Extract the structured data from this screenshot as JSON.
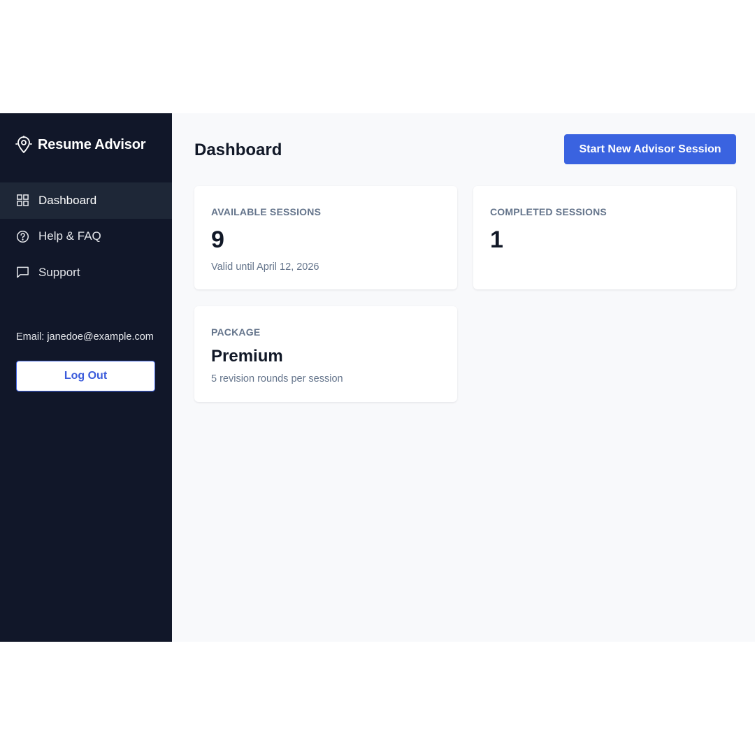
{
  "brand": {
    "name": "Resume Advisor",
    "icon": "location-pin-icon"
  },
  "nav": {
    "items": [
      {
        "label": "Dashboard",
        "icon": "grid-icon",
        "active": true
      },
      {
        "label": "Help & FAQ",
        "icon": "help-circle-icon",
        "active": false
      },
      {
        "label": "Support",
        "icon": "message-square-icon",
        "active": false
      }
    ]
  },
  "user": {
    "email": "Email: janedoe@example.com"
  },
  "logout_label": "Log Out",
  "main": {
    "title": "Dashboard",
    "primary_action": "Start New Advisor Session"
  },
  "cards": {
    "available": {
      "label": "AVAILABLE SESSIONS",
      "value": "9",
      "sub": "Valid until April 12, 2026"
    },
    "completed": {
      "label": "COMPLETED SESSIONS",
      "value": "1"
    },
    "package": {
      "label": "PACKAGE",
      "value": "Premium",
      "sub": "5 revision rounds per session"
    }
  },
  "colors": {
    "sidebar_bg": "#111729",
    "sidebar_active": "#1e2737",
    "accent": "#3a63e0",
    "main_bg": "#f8f9fb"
  }
}
